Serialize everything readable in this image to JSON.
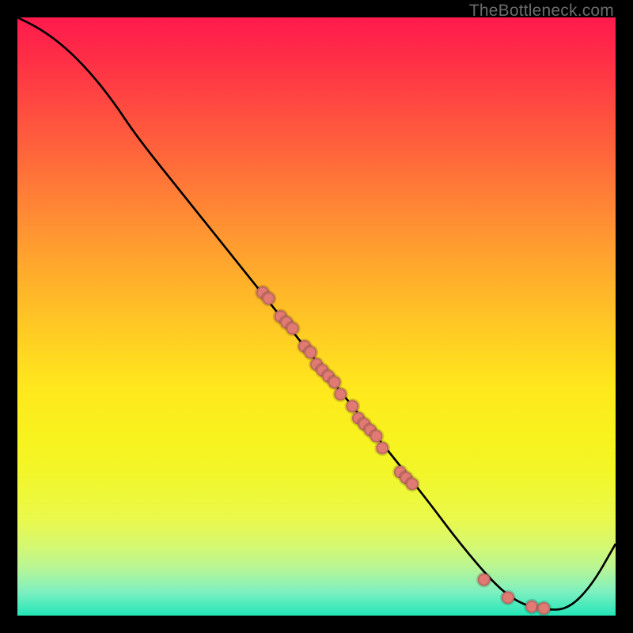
{
  "watermark": "TheBottleneck.com",
  "colors": {
    "dot": "#e07a73",
    "curve": "#000000"
  },
  "chart_data": {
    "type": "line",
    "title": "",
    "xlabel": "",
    "ylabel": "",
    "xlim": [
      0,
      100
    ],
    "ylim": [
      0,
      100
    ],
    "grid": false,
    "series": [
      {
        "name": "curve",
        "x": [
          0,
          4,
          8,
          12,
          16,
          20,
          28,
          36,
          44,
          52,
          60,
          68,
          74,
          80,
          84,
          88,
          92,
          96,
          100
        ],
        "y": [
          100,
          98,
          95,
          91,
          86,
          80,
          70,
          60,
          50,
          40,
          30,
          20,
          12,
          5,
          2,
          1,
          1,
          5,
          12
        ]
      }
    ],
    "scatter": {
      "name": "highlight-points",
      "x": [
        41,
        42,
        44,
        45,
        46,
        48,
        49,
        50,
        51,
        52,
        53,
        54,
        56,
        57,
        58,
        59,
        60,
        61,
        64,
        65,
        66,
        78,
        82,
        86,
        88
      ],
      "y": [
        54,
        53,
        50,
        49,
        48,
        45,
        44,
        42,
        41,
        40,
        39,
        37,
        35,
        33,
        32,
        31,
        30,
        28,
        24,
        23,
        22,
        6,
        3,
        1.5,
        1.2
      ]
    }
  }
}
